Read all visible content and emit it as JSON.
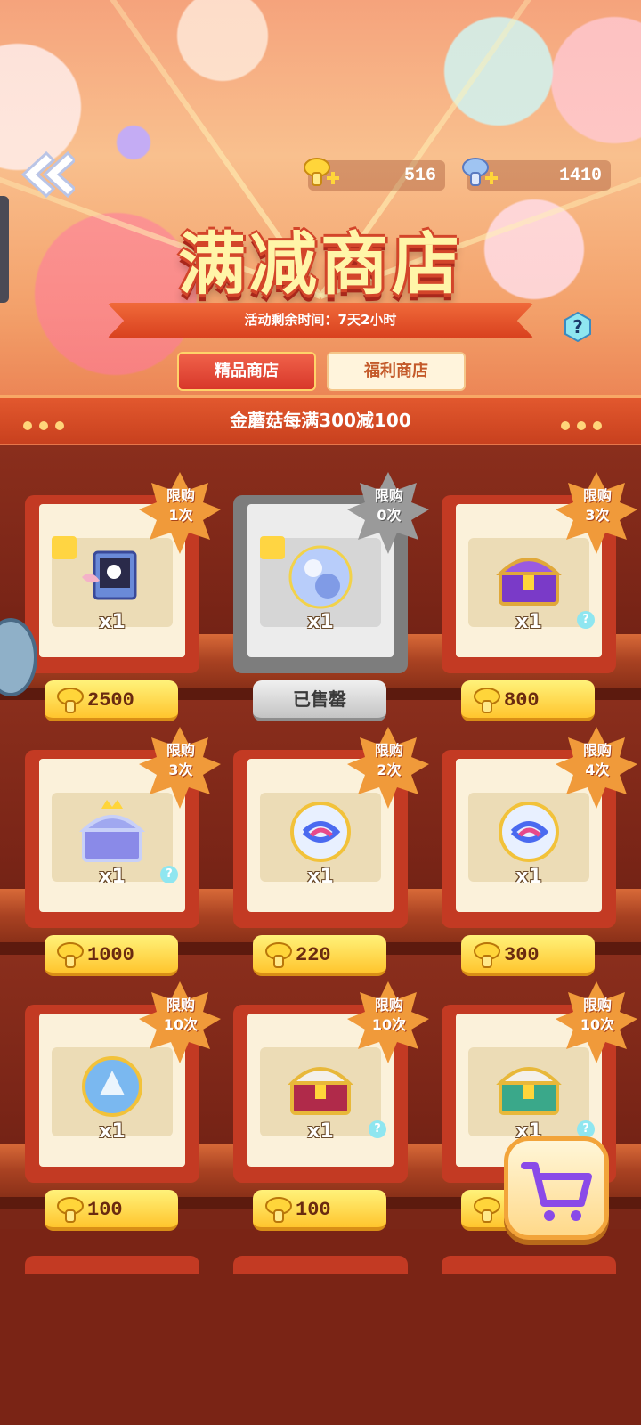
{
  "header": {
    "title": "满减商店",
    "event_time": "活动剩余时间：7天2小时",
    "promo": "金蘑菇每满300减100"
  },
  "currencies": [
    {
      "name": "gold-mushroom",
      "value": "516"
    },
    {
      "name": "blue-mushroom",
      "value": "1410"
    }
  ],
  "tabs": [
    {
      "label": "精品商店",
      "active": true
    },
    {
      "label": "福利商店",
      "active": false
    }
  ],
  "items": [
    {
      "limit": "限购\n1次",
      "qty": "x1",
      "price": "2500",
      "icon": "photo-frame-icon"
    },
    {
      "limit": "限购\n0次",
      "qty": "x1",
      "price": "",
      "sold_label": "已售罄",
      "icon": "crystal-orb-icon"
    },
    {
      "limit": "限购\n3次",
      "qty": "x1",
      "price": "800",
      "icon": "purple-chest-icon"
    },
    {
      "limit": "限购\n3次",
      "qty": "x1",
      "price": "1000",
      "icon": "crown-chest-icon"
    },
    {
      "limit": "限购\n2次",
      "qty": "x1",
      "price": "220",
      "icon": "swirl-orb-icon"
    },
    {
      "limit": "限购\n4次",
      "qty": "x1",
      "price": "300",
      "icon": "swirl-orb-icon"
    },
    {
      "limit": "限购\n10次",
      "qty": "x1",
      "price": "100",
      "icon": "shell-orb-icon"
    },
    {
      "limit": "限购\n10次",
      "qty": "x1",
      "price": "100",
      "icon": "red-chest-icon"
    },
    {
      "limit": "限购\n10次",
      "qty": "x1",
      "price": "",
      "icon": "green-chest-icon"
    }
  ],
  "colors": {
    "accent": "#d8382a",
    "gold": "#ffc52e",
    "shelf": "#7a2517"
  }
}
